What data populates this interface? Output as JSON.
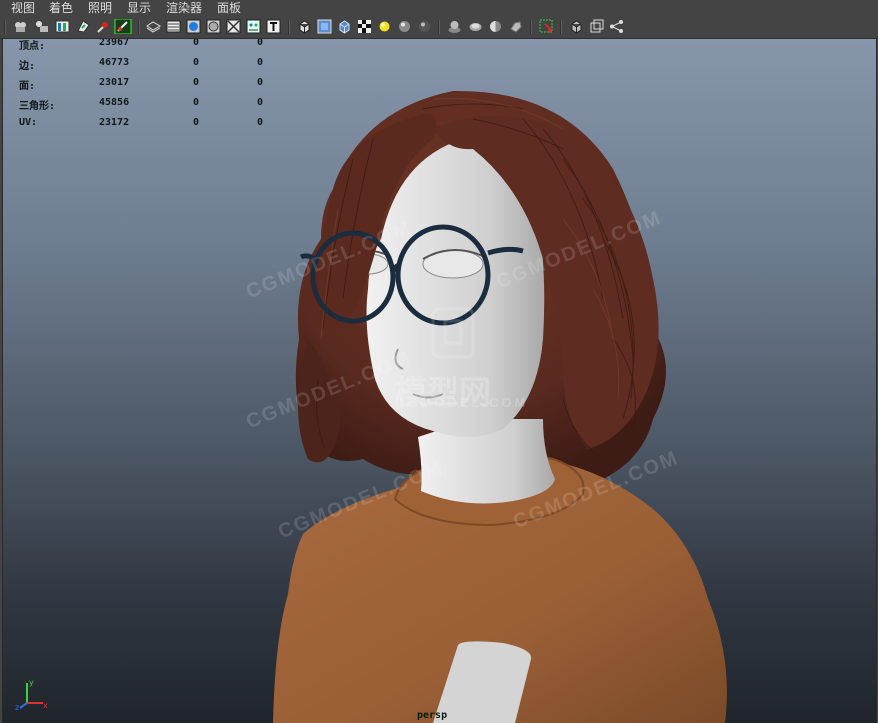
{
  "menu": [
    "视图",
    "着色",
    "照明",
    "显示",
    "渲染器",
    "面板"
  ],
  "toolbar_icons": [
    "camera-select-icon",
    "camera-attributes-icon",
    "bookmarks-icon",
    "image-plane-icon",
    "resolution-gate-icon",
    "film-gate-icon",
    "wireframe-icon",
    "smooth-shade-icon",
    "default-material-icon",
    "shaded-wireframe-icon",
    "bounding-box-icon",
    "texture-icon",
    "cube-outline-icon",
    "cube-shaded-icon",
    "cube-textured-icon",
    "checker-icon",
    "light-icon",
    "sphere-default-icon",
    "sphere-shadow-icon",
    "multisample-icon",
    "ambient-occlusion-icon",
    "motion-blur-icon",
    "antialias-icon",
    "isolate-select-icon",
    "xray-icon",
    "xray-joints-icon",
    "xray-active-icon"
  ],
  "stats": {
    "rows": [
      {
        "label": "顶点:",
        "v1": "23967",
        "v2": "0",
        "v3": "0"
      },
      {
        "label": "边:",
        "v1": "46773",
        "v2": "0",
        "v3": "0"
      },
      {
        "label": "面:",
        "v1": "23017",
        "v2": "0",
        "v3": "0"
      },
      {
        "label": "三角形:",
        "v1": "45856",
        "v2": "0",
        "v3": "0"
      },
      {
        "label": "UV:",
        "v1": "23172",
        "v2": "0",
        "v3": "0"
      }
    ]
  },
  "camera_label": "persp",
  "watermark": {
    "brand": "CGMODEL.COM",
    "logo_text": "模型网"
  },
  "axis": {
    "x": "x",
    "y": "y",
    "z": "z"
  },
  "colors": {
    "hair": "#5a2a1f",
    "sweater": "#a86a3e",
    "skin": "#d2d2d2",
    "glasses": "#1a2c3e"
  }
}
